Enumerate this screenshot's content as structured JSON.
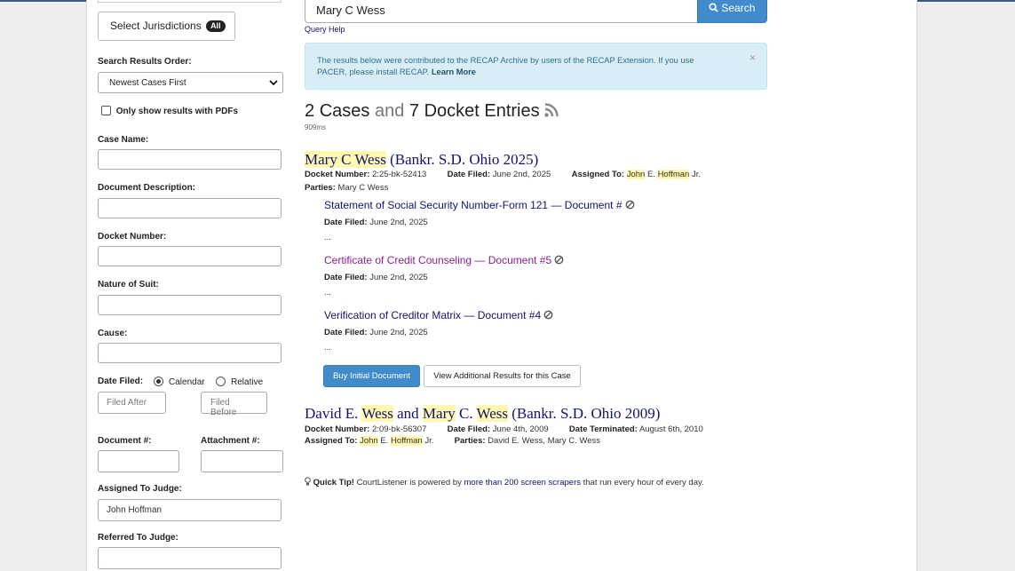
{
  "sidebar": {
    "jurisdictions_label": "Select Jurisdictions",
    "jurisdictions_badge": "All",
    "order_label": "Search Results Order:",
    "order_value": "Newest Cases First",
    "pdf_only_label": "Only show results with PDFs",
    "case_name_label": "Case Name:",
    "doc_desc_label": "Document Description:",
    "docket_number_label": "Docket Number:",
    "nature_label": "Nature of Suit:",
    "cause_label": "Cause:",
    "date_filed_label": "Date Filed:",
    "calendar_label": "Calendar",
    "relative_label": "Relative",
    "filed_after_placeholder": "Filed After",
    "filed_before_placeholder": "Filed Before",
    "document_num_label": "Document #:",
    "attachment_num_label": "Attachment #:",
    "assigned_label": "Assigned To Judge:",
    "assigned_value": "John Hoffman",
    "referred_label": "Referred To Judge:"
  },
  "search": {
    "query": "Mary C Wess",
    "button_label": "Search",
    "query_help": "Query Help"
  },
  "alert": {
    "text": "The results below were contributed to the RECAP Archive by users of the RECAP Extension. If you use PACER, please install RECAP.",
    "learn_more": "Learn More",
    "close": "×"
  },
  "summary": {
    "cases_count": "2",
    "cases_word": "Cases",
    "and_word": "and",
    "entries_count": "7",
    "entries_word": "Docket Entries",
    "timing": "909ms"
  },
  "results": [
    {
      "title_name": "Mary C Wess",
      "title_court": "(Bankr. S.D. Ohio 2025)",
      "docket_label": "Docket Number:",
      "docket_value": "2:25-bk-52413",
      "filed_label": "Date Filed:",
      "filed_value": "June 2nd, 2025",
      "assigned_label": "Assigned To:",
      "assigned_first": "John",
      "assigned_mid": "E.",
      "assigned_last": "Hoffman",
      "assigned_suffix": "Jr.",
      "parties_label": "Parties:",
      "parties_value": "Mary C Wess",
      "entries": [
        {
          "title": "Statement of Social Security Number-Form 121",
          "sep": "—",
          "doc": "Document #",
          "filed_label": "Date Filed:",
          "filed_value": "June 2nd, 2025",
          "ellipsis": "...",
          "color": "#10146f"
        },
        {
          "title": "Certificate of Credit Counseling",
          "sep": "—",
          "doc": "Document #5",
          "filed_label": "Date Filed:",
          "filed_value": "June 2nd, 2025",
          "ellipsis": "...",
          "color": "#8a1e8e"
        },
        {
          "title": "Verification of Creditor Matrix",
          "sep": "—",
          "doc": "Document #4",
          "filed_label": "Date Filed:",
          "filed_value": "June 2nd, 2025",
          "ellipsis": "...",
          "color": "#10146f"
        }
      ],
      "buy_label": "Buy Initial Document",
      "view_more_label": "View Additional Results for this Case"
    },
    {
      "title_a_first": "David E.",
      "title_a_last": "Wess",
      "title_and": "and",
      "title_b_first": "Mary",
      "title_b_mid": "C.",
      "title_b_last": "Wess",
      "title_court": "(Bankr. S.D. Ohio 2009)",
      "docket_label": "Docket Number:",
      "docket_value": "2:09-bk-56307",
      "filed_label": "Date Filed:",
      "filed_value": "June 4th, 2009",
      "terminated_label": "Date Terminated:",
      "terminated_value": "August 6th, 2010",
      "assigned_label": "Assigned To:",
      "assigned_first": "John",
      "assigned_mid": "E.",
      "assigned_last": "Hoffman",
      "assigned_suffix": "Jr.",
      "parties_label": "Parties:",
      "parties_value": "David E. Wess, Mary C. Wess"
    }
  ],
  "tip": {
    "label": "Quick Tip!",
    "text_before": "CourtListener is powered by",
    "link": "more than 200 screen scrapers",
    "text_after": "that run every hour of every day."
  },
  "colors": {
    "accent": "#428bca",
    "link": "#10146f",
    "visited": "#8a1e8e",
    "highlight": "#fff9b0",
    "alert_bg": "#d9edf7"
  }
}
